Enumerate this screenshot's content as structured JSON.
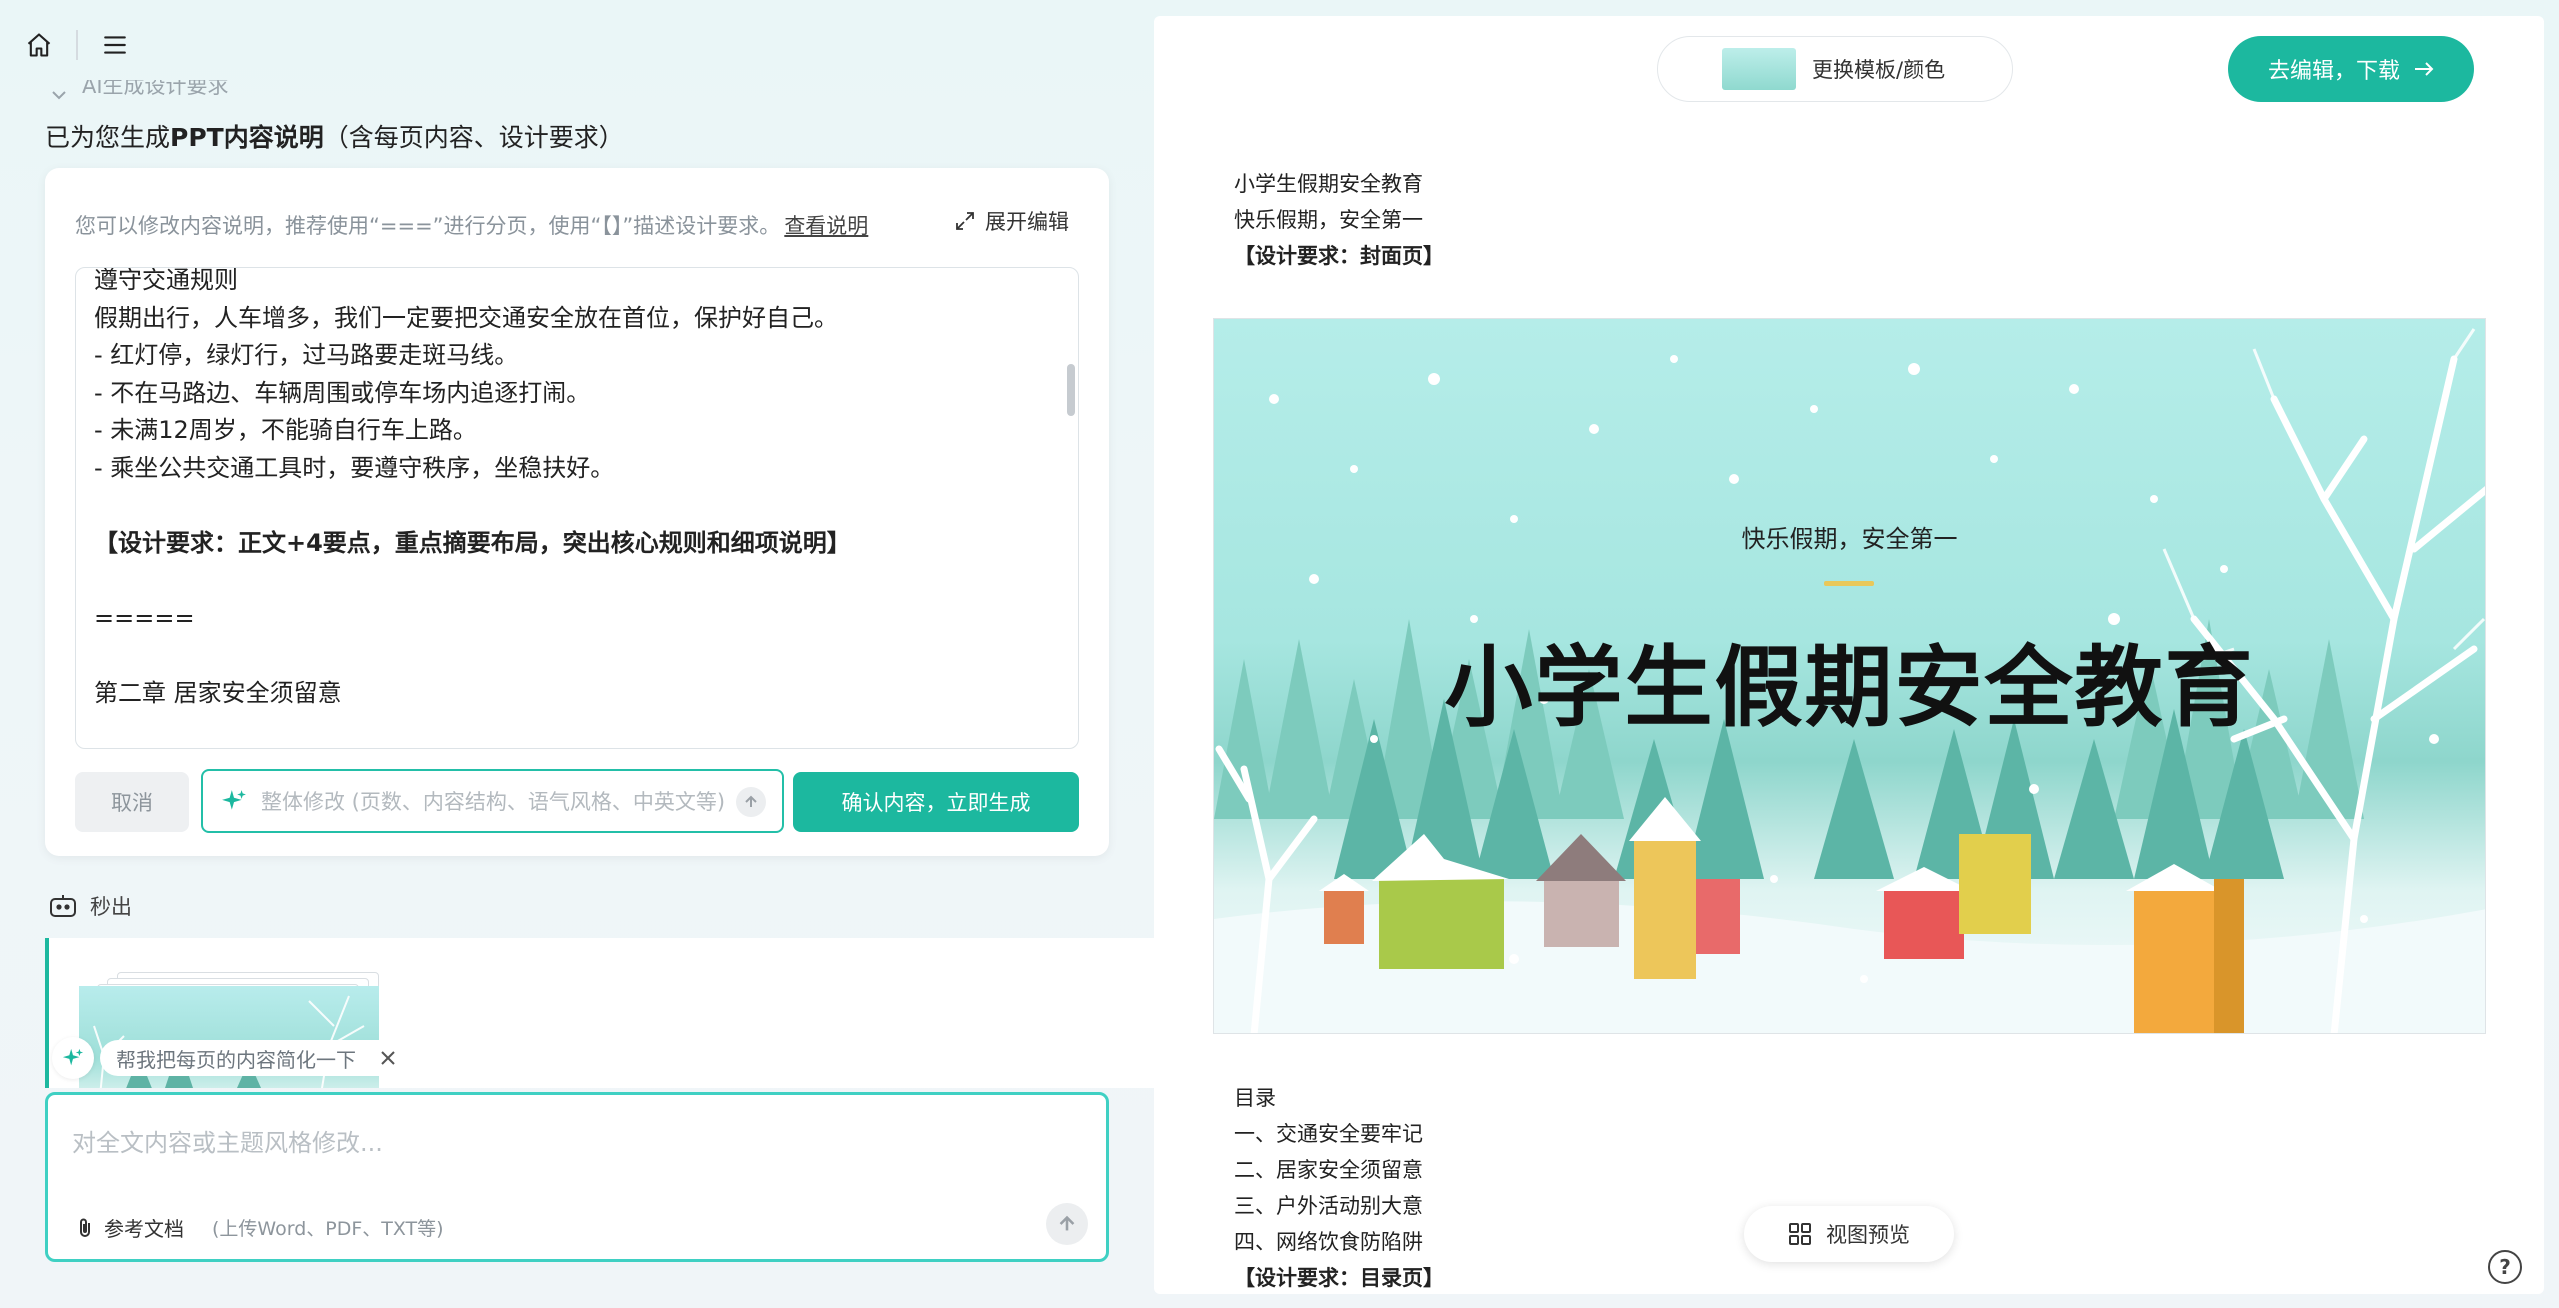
{
  "nav": {
    "home_icon": "home-icon",
    "menu_icon": "menu-icon"
  },
  "section_collapsed": "AI生成设计要求",
  "generated_title": {
    "prefix": "已为您生成",
    "bold": "PPT内容说明",
    "suffix": "（含每页内容、设计要求）"
  },
  "editor": {
    "hint": "您可以修改内容说明，推荐使用“===”进行分页，使用“【】”描述设计要求。",
    "hint_link": "查看说明",
    "expand_label": "展开编辑",
    "lines": [
      {
        "text": "遵守交通规则",
        "bold": false
      },
      {
        "text": "假期出行，人车增多，我们一定要把交通安全放在首位，保护好自己。",
        "bold": false
      },
      {
        "text": "- 红灯停，绿灯行，过马路要走斑马线。",
        "bold": false
      },
      {
        "text": "- 不在马路边、车辆周围或停车场内追逐打闹。",
        "bold": false
      },
      {
        "text": "- 未满12周岁，不能骑自行车上路。",
        "bold": false
      },
      {
        "text": "- 乘坐公共交通工具时，要遵守秩序，坐稳扶好。",
        "bold": false
      },
      {
        "text": "",
        "bold": false
      },
      {
        "text": "【设计要求：正文+4要点，重点摘要布局，突出核心规则和细项说明】",
        "bold": true
      },
      {
        "text": "",
        "bold": false
      },
      {
        "text": "=====",
        "bold": false
      },
      {
        "text": "",
        "bold": false
      },
      {
        "text": "第二章 居家安全须留意",
        "bold": false
      }
    ],
    "cancel_label": "取消",
    "modify_placeholder": "整体修改 (页数、内容结构、语气风格、中英文等)",
    "confirm_label": "确认内容，立即生成"
  },
  "output_section": {
    "label": "秒出",
    "suggestion": "帮我把每页的内容简化一下"
  },
  "chat": {
    "placeholder": "对全文内容或主题风格修改...",
    "ref_label": "参考文档",
    "ref_sub": "(上传Word、PDF、TXT等)"
  },
  "preview": {
    "template_btn": "更换模板/颜色",
    "download_btn": "去编辑，下载",
    "cover_outline": [
      "小学生假期安全教育",
      "快乐假期，安全第一"
    ],
    "cover_design": "【设计要求：封面页】",
    "slide": {
      "subtitle": "快乐假期，安全第一",
      "title": "小学生假期安全教育"
    },
    "toc": [
      "目录",
      "一、交通安全要牢记",
      "二、居家安全须留意",
      "三、户外活动别大意",
      "四、网络饮食防陷阱"
    ],
    "toc_design": "【设计要求：目录页】",
    "view_btn": "视图预览",
    "help": "?"
  },
  "colors": {
    "accent": "#1cb89f",
    "accent_border": "#3fd0c3"
  }
}
